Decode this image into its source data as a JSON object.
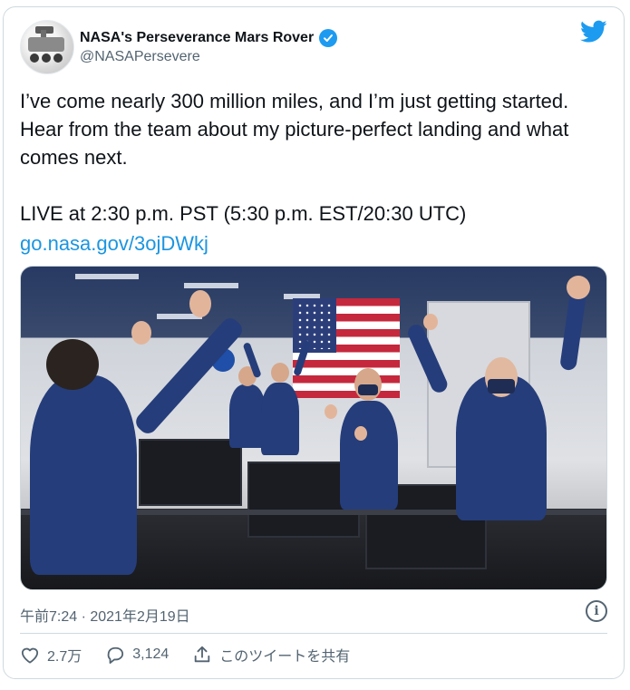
{
  "author": {
    "name": "NASA's Perseverance Mars Rover",
    "handle": "@NASAPersevere",
    "verified": true
  },
  "tweet": {
    "text": "I’ve come nearly 300 million miles, and I’m just getting started. Hear from the team about my picture-perfect landing and what comes next.\n\nLIVE at 2:30 p.m. PST (5:30 p.m. EST/20:30 UTC)",
    "link": "go.nasa.gov/3ojDWkj",
    "timestamp": "午前7:24 · 2021年2月19日"
  },
  "actions": {
    "likes": "2.7万",
    "replies": "3,124",
    "share_label": "このツイートを共有"
  },
  "colors": {
    "accent": "#1d9bf0",
    "link": "#1b95e0",
    "secondary_text": "#536471",
    "border": "#cfd9de"
  },
  "icons": [
    "twitter-bird-icon",
    "verified-badge-icon",
    "info-icon",
    "heart-icon",
    "reply-icon",
    "share-icon"
  ]
}
